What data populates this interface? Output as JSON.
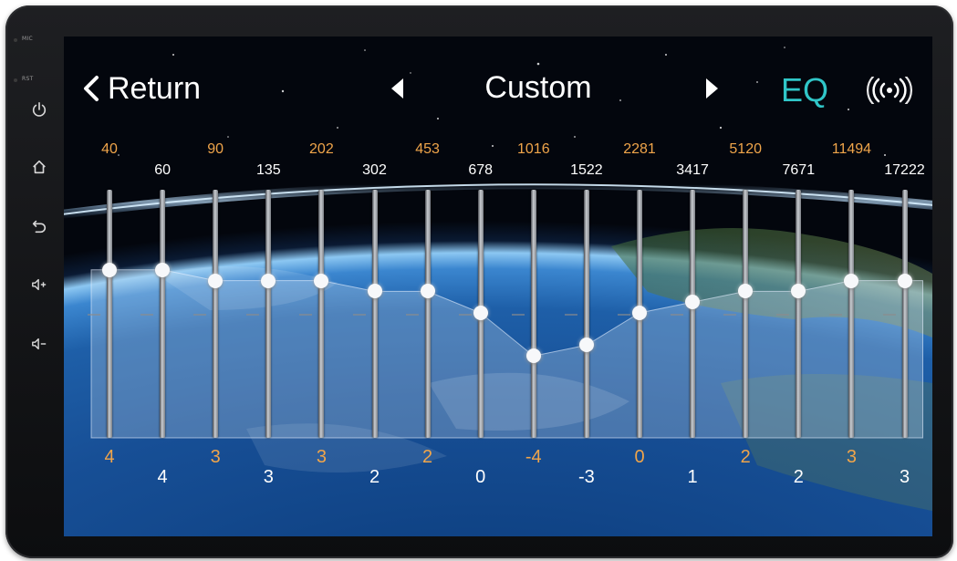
{
  "device": {
    "side_labels": {
      "mic": "MIC",
      "rst": "RST"
    },
    "side_buttons": [
      "power-icon",
      "home-icon",
      "back-icon",
      "volume-up-icon",
      "volume-down-icon"
    ]
  },
  "header": {
    "return_label": "Return",
    "preset_name": "Custom",
    "eq_label": "EQ",
    "icons": {
      "return": "chevron-left-icon",
      "prev": "triangle-left-icon",
      "next": "triangle-right-icon",
      "surround": "broadcast-icon"
    },
    "eq_color": "#30c6c8"
  },
  "equalizer": {
    "accent_color": "#f0a54a",
    "gain_range": [
      -10,
      10
    ],
    "bands": [
      {
        "freq": "40",
        "gain": 4,
        "gain_label": "4"
      },
      {
        "freq": "60",
        "gain": 4,
        "gain_label": "4"
      },
      {
        "freq": "90",
        "gain": 3,
        "gain_label": "3"
      },
      {
        "freq": "135",
        "gain": 3,
        "gain_label": "3"
      },
      {
        "freq": "202",
        "gain": 3,
        "gain_label": "3"
      },
      {
        "freq": "302",
        "gain": 2,
        "gain_label": "2"
      },
      {
        "freq": "453",
        "gain": 2,
        "gain_label": "2"
      },
      {
        "freq": "678",
        "gain": 0,
        "gain_label": "0"
      },
      {
        "freq": "1016",
        "gain": -4,
        "gain_label": "-4"
      },
      {
        "freq": "1522",
        "gain": -3,
        "gain_label": "-3"
      },
      {
        "freq": "2281",
        "gain": 0,
        "gain_label": "0"
      },
      {
        "freq": "3417",
        "gain": 1,
        "gain_label": "1"
      },
      {
        "freq": "5120",
        "gain": 2,
        "gain_label": "2"
      },
      {
        "freq": "7671",
        "gain": 2,
        "gain_label": "2"
      },
      {
        "freq": "11494",
        "gain": 3,
        "gain_label": "3"
      },
      {
        "freq": "17222",
        "gain": 3,
        "gain_label": "3"
      }
    ]
  }
}
